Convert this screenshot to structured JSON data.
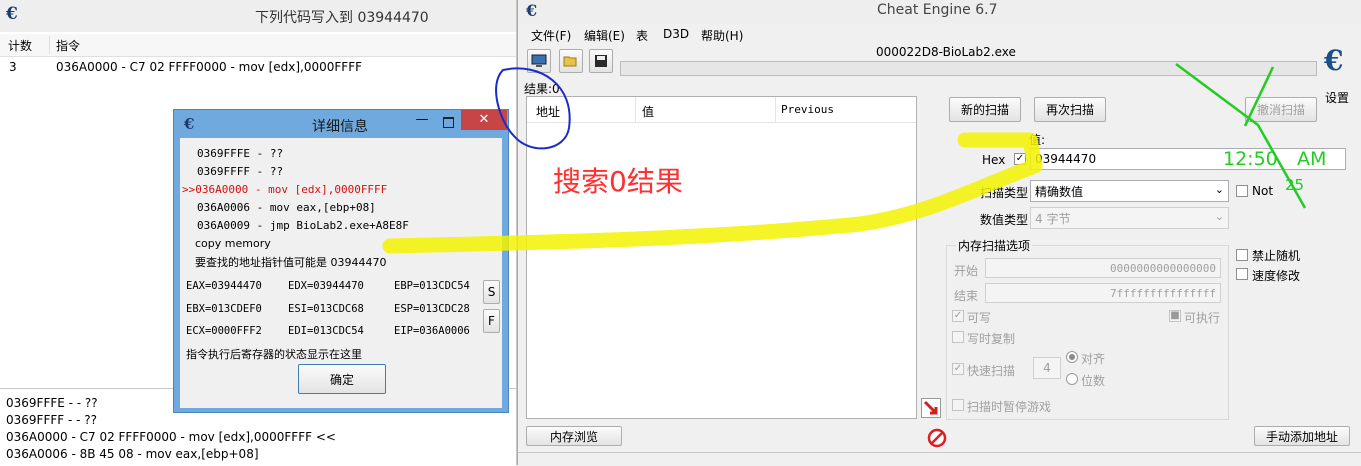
{
  "left_window": {
    "title": "下列代码写入到 03944470",
    "columns": [
      "计数",
      "指令"
    ],
    "rows": [
      {
        "count": "3",
        "instr": "036A0000 - C7 02 FFFF0000 - mov [edx],0000FFFF"
      }
    ],
    "disasm_lines": [
      "0369FFFE -  - ??",
      "0369FFFF -  - ??",
      "036A0000 - C7 02 FFFF0000 - mov [edx],0000FFFF <<",
      "036A0006 - 8B 45 08  - mov eax,[ebp+08]"
    ]
  },
  "detail_dialog": {
    "title": "详细信息",
    "code_lines": [
      {
        "text": "0369FFFE - ??",
        "prefix": ""
      },
      {
        "text": "0369FFFF - ??",
        "prefix": ""
      },
      {
        "text": "036A0000 - mov [edx],0000FFFF",
        "prefix": ">>"
      },
      {
        "text": "036A0006 - mov eax,[ebp+08]",
        "prefix": ""
      },
      {
        "text": "036A0009 - jmp BioLab2.exe+A8E8F",
        "prefix": ""
      }
    ],
    "copy_memory": "copy memory",
    "pointer_note": "要查找的地址指针值可能是 03944470",
    "registers": [
      [
        "EAX=03944470",
        "EDX=03944470",
        "EBP=013CDC54"
      ],
      [
        "EBX=013CDEF0",
        "ESI=013CDC68",
        "ESP=013CDC28"
      ],
      [
        "ECX=0000FFF2",
        "EDI=013CDC54",
        "EIP=036A0006"
      ]
    ],
    "s_button": "S",
    "f_button": "F",
    "status": "指令执行后寄存器的状态显示在这里",
    "ok": "确定"
  },
  "ce": {
    "title": "Cheat Engine 6.7",
    "menu": [
      "文件(F)",
      "编辑(E)",
      "表",
      "D3D",
      "帮助(H)"
    ],
    "process": "000022D8-BioLab2.exe",
    "settings": "设置",
    "results_label": "结果:0",
    "columns": [
      "地址",
      "值",
      "Previous"
    ],
    "new_scan": "新的扫描",
    "next_scan": "再次扫描",
    "undo_scan": "撤消扫描",
    "value_label": "值:",
    "hex_label": "Hex",
    "hex_checked": true,
    "value_input": "03944470",
    "scan_type_label": "扫描类型",
    "scan_type": "精确数值",
    "not_label": "Not",
    "value_type_label": "数值类型",
    "value_type": "4 字节",
    "memory_options": "内存扫描选项",
    "start_label": "开始",
    "start_value": "0000000000000000",
    "stop_label": "结束",
    "stop_value": "7fffffffffffffff",
    "writable": "可写",
    "executable": "可执行",
    "copy_on_write": "写时复制",
    "fast_scan": "快速扫描",
    "fast_scan_value": "4",
    "align": "对齐",
    "last_digits": "位数",
    "pause_game": "扫描时暂停游戏",
    "disable_random": "禁止随机",
    "speed_hack": "速度修改",
    "memory_view": "内存浏览",
    "add_address": "手动添加地址"
  },
  "annotations": {
    "search_text": "搜索0结果",
    "clock_time": "12:50",
    "clock_ampm": "AM",
    "clock_num": "25"
  },
  "colors": {
    "annotation_red": "#ff3030",
    "annotation_blue": "#1a2cc8",
    "highlight_yellow": "#f2f200",
    "annotation_green": "#22cc22",
    "dialog_border": "#6fa9dd",
    "close_red": "#c74545"
  }
}
